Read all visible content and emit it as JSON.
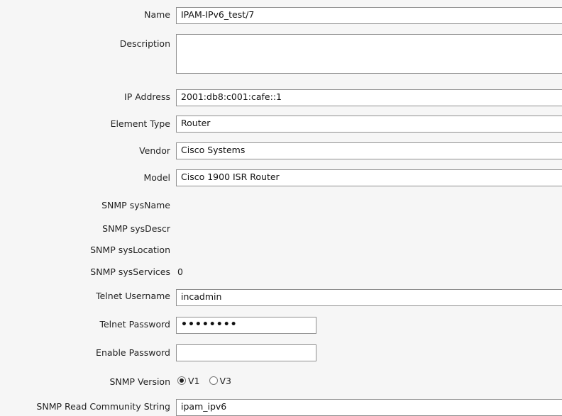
{
  "form": {
    "name": {
      "label": "Name",
      "value": "IPAM-IPv6_test/7"
    },
    "description": {
      "label": "Description",
      "value": ""
    },
    "ip_address": {
      "label": "IP Address",
      "value": "2001:db8:c001:cafe::1"
    },
    "element_type": {
      "label": "Element Type",
      "value": "Router"
    },
    "vendor": {
      "label": "Vendor",
      "value": "Cisco Systems"
    },
    "model": {
      "label": "Model",
      "value": "Cisco 1900 ISR Router"
    },
    "snmp_sysname": {
      "label": "SNMP sysName",
      "value": ""
    },
    "snmp_sysdescr": {
      "label": "SNMP sysDescr",
      "value": ""
    },
    "snmp_syslocation": {
      "label": "SNMP sysLocation",
      "value": ""
    },
    "snmp_sysservices": {
      "label": "SNMP sysServices",
      "value": "0"
    },
    "telnet_username": {
      "label": "Telnet Username",
      "value": "incadmin"
    },
    "telnet_password": {
      "label": "Telnet Password",
      "value": "••••••••"
    },
    "enable_password": {
      "label": "Enable Password",
      "value": ""
    },
    "snmp_version": {
      "label": "SNMP Version",
      "options": [
        "V1",
        "V3"
      ],
      "selected": "V1"
    },
    "snmp_read_community": {
      "label": "SNMP Read Community String",
      "value": "ipam_ipv6"
    }
  }
}
